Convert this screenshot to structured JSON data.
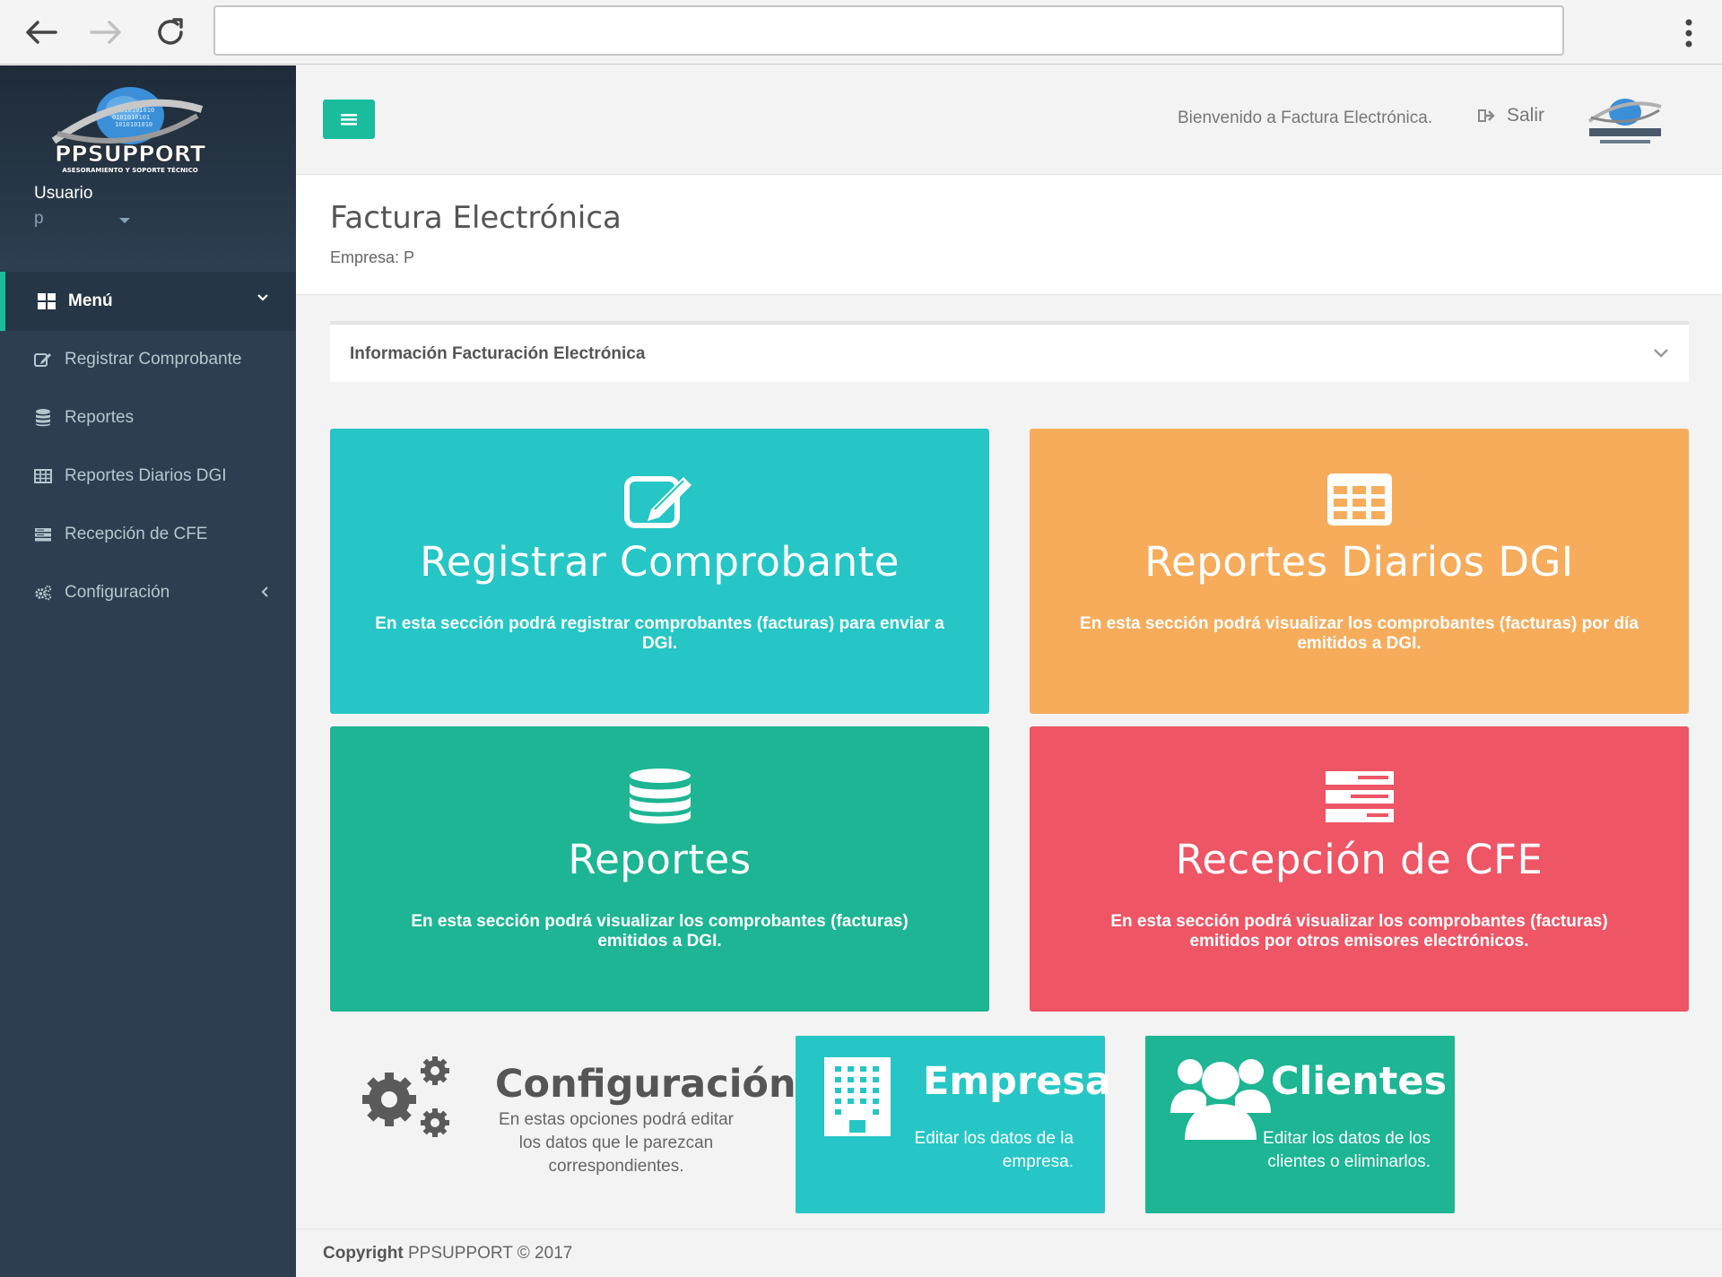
{
  "browser": {
    "address_value": ""
  },
  "sidebar": {
    "logo": {
      "brand": "PPSUPPORT",
      "tagline": "ASESORAMIENTO Y SOPORTE TÉCNICO"
    },
    "user_label": "Usuario",
    "user_name": "p",
    "menu_label": "Menú",
    "items": [
      {
        "label": "Registrar Comprobante",
        "icon": "edit-icon"
      },
      {
        "label": "Reportes",
        "icon": "database-icon"
      },
      {
        "label": "Reportes Diarios DGI",
        "icon": "table-icon"
      },
      {
        "label": "Recepción de CFE",
        "icon": "server-icon"
      },
      {
        "label": "Configuración",
        "icon": "cogs-icon"
      }
    ]
  },
  "header": {
    "welcome": "Bienvenido a Factura Electrónica.",
    "logout_label": "Salir"
  },
  "page": {
    "title": "Factura Electrónica",
    "company": "Empresa: P"
  },
  "info_panel": {
    "title": "Información Facturación Electrónica"
  },
  "tiles": [
    {
      "title": "Registrar Comprobante",
      "desc": "En esta sección podrá registrar comprobantes (facturas) para enviar a DGI.",
      "color": "#26c6c6",
      "icon": "edit-icon"
    },
    {
      "title": "Reportes Diarios DGI",
      "desc": "En esta sección podrá visualizar los comprobantes (facturas) por día emitidos a DGI.",
      "color": "#f7ac5b",
      "icon": "table-icon"
    },
    {
      "title": "Reportes",
      "desc": "En esta sección podrá visualizar los comprobantes (facturas) emitidos a DGI.",
      "color": "#1db594",
      "icon": "database-icon"
    },
    {
      "title": "Recepción de CFE",
      "desc": "En esta sección podrá visualizar los comprobantes (facturas) emitidos por otros emisores electrónicos.",
      "color": "#ee5565",
      "icon": "server-icon"
    }
  ],
  "config": {
    "title": "Configuración",
    "desc": "En estas opciones podrá editar los datos que le parezcan correspondientes."
  },
  "empresa": {
    "title": "Empresa",
    "desc": "Editar los datos de la empresa."
  },
  "clientes": {
    "title": "Clientes",
    "desc": "Editar los datos de los clientes o eliminarlos."
  },
  "footer": {
    "copyright_label": "Copyright",
    "copyright_text": "PPSUPPORT © 2017"
  }
}
